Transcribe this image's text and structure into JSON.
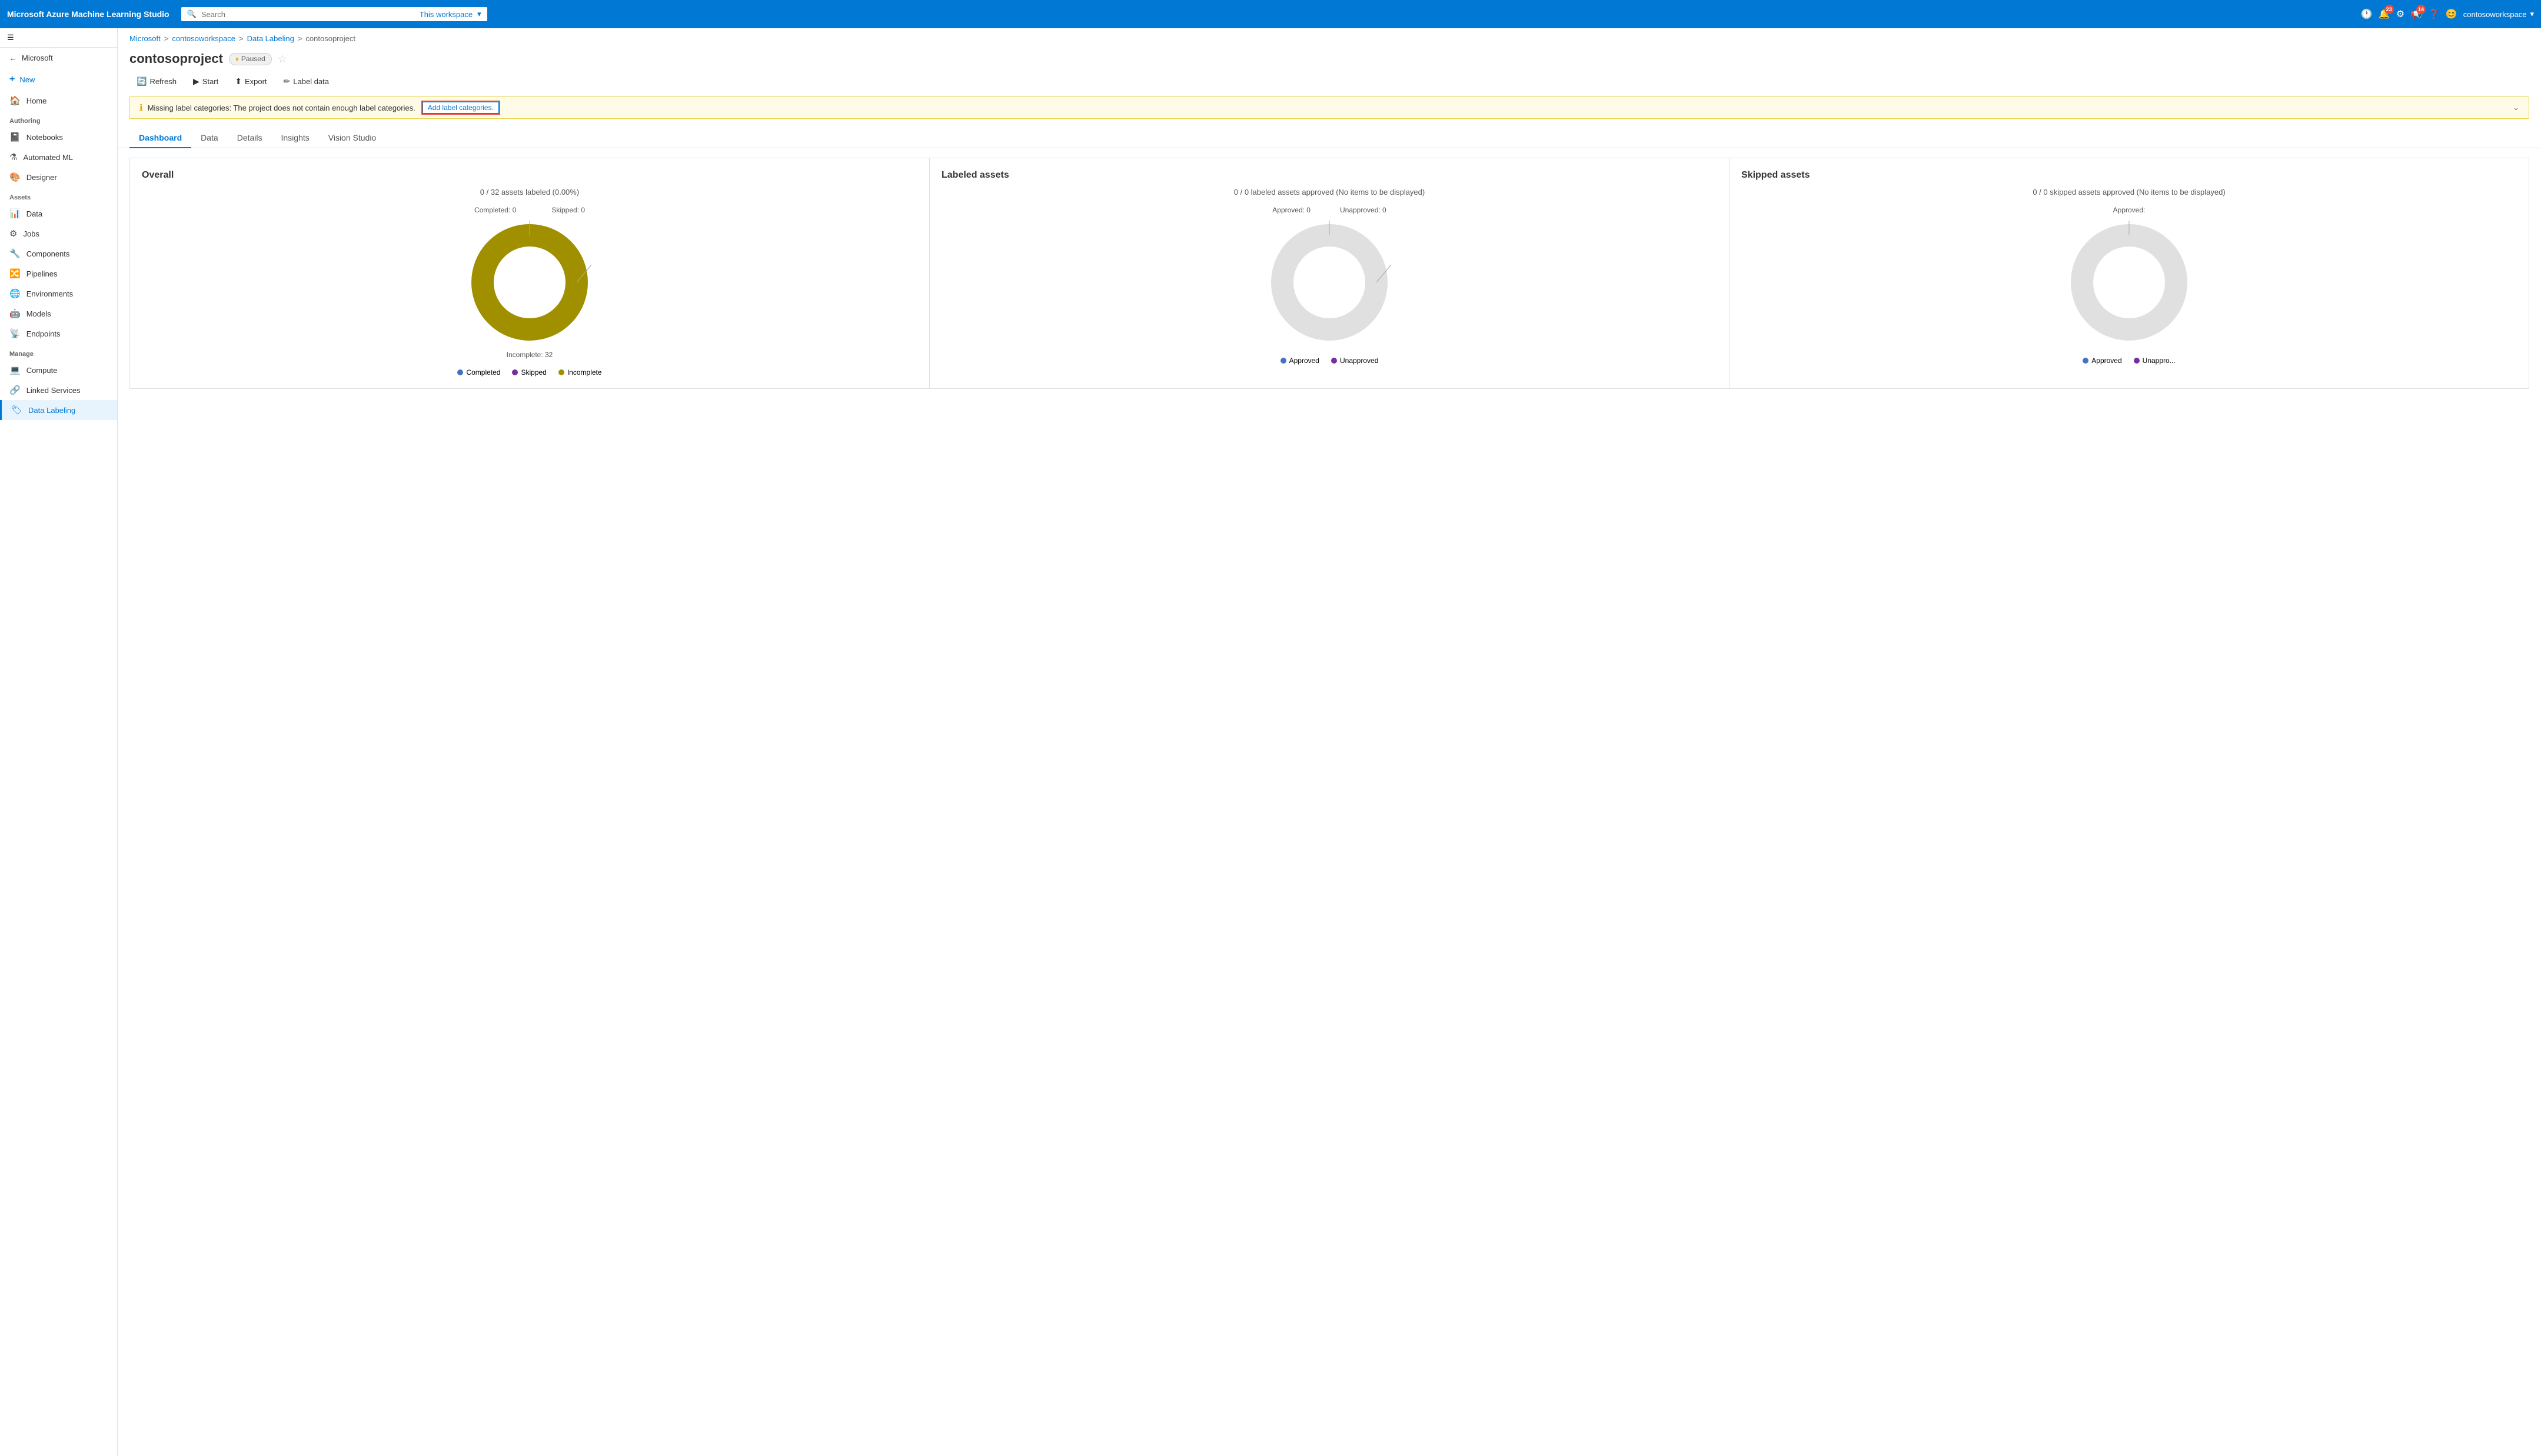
{
  "app": {
    "title": "Microsoft Azure Machine Learning Studio"
  },
  "search": {
    "placeholder": "Search",
    "workspace_label": "This workspace"
  },
  "topnav": {
    "notifications_badge": "23",
    "updates_badge": "14",
    "username": "contosoworkspace",
    "chevron": "▾"
  },
  "sidebar": {
    "menu_icon": "☰",
    "microsoft_label": "Microsoft",
    "new_label": "New",
    "home_label": "Home",
    "authoring_label": "Authoring",
    "notebooks_label": "Notebooks",
    "automated_ml_label": "Automated ML",
    "designer_label": "Designer",
    "assets_label": "Assets",
    "data_label": "Data",
    "jobs_label": "Jobs",
    "components_label": "Components",
    "pipelines_label": "Pipelines",
    "environments_label": "Environments",
    "models_label": "Models",
    "endpoints_label": "Endpoints",
    "manage_label": "Manage",
    "compute_label": "Compute",
    "linked_services_label": "Linked Services",
    "data_labeling_label": "Data Labeling"
  },
  "breadcrumb": {
    "microsoft": "Microsoft",
    "workspace": "contosoworkspace",
    "data_labeling": "Data Labeling",
    "project": "contosoproject"
  },
  "page": {
    "title": "contosoproject",
    "status": "Paused",
    "toolbar": {
      "refresh": "Refresh",
      "start": "Start",
      "export": "Export",
      "label_data": "Label data"
    }
  },
  "warning": {
    "text": "Missing label categories: The project does not contain enough label categories.",
    "cta": "Add label categories."
  },
  "tabs": {
    "dashboard": "Dashboard",
    "data": "Data",
    "details": "Details",
    "insights": "Insights",
    "vision_studio": "Vision Studio"
  },
  "overall_card": {
    "title": "Overall",
    "subtitle": "0 / 32 assets labeled (0.00%)",
    "completed_label": "Completed: 0",
    "skipped_label": "Skipped: 0",
    "incomplete_label": "Incomplete: 32",
    "legend": {
      "completed": "Completed",
      "skipped": "Skipped",
      "incomplete": "Incomplete"
    },
    "chart": {
      "completed": 0,
      "skipped": 0,
      "incomplete": 32,
      "total": 32
    }
  },
  "labeled_assets_card": {
    "title": "Labeled assets",
    "subtitle": "0 / 0 labeled assets approved (No items to be displayed)",
    "approved_label": "Approved: 0",
    "unapproved_label": "Unapproved: 0",
    "legend": {
      "approved": "Approved",
      "unapproved": "Unapproved"
    }
  },
  "skipped_assets_card": {
    "title": "Skipped assets",
    "subtitle": "0 / 0 skipped assets approved (No items to be displayed)",
    "approved_label": "Approved:",
    "legend": {
      "approved": "Approved",
      "unapproved": "Unappro..."
    }
  },
  "colors": {
    "completed": "#4472c4",
    "skipped": "#7030a0",
    "incomplete": "#7d7000",
    "approved": "#4472c4",
    "unapproved": "#7030a0",
    "chart_bg": "#d4d4d4"
  }
}
